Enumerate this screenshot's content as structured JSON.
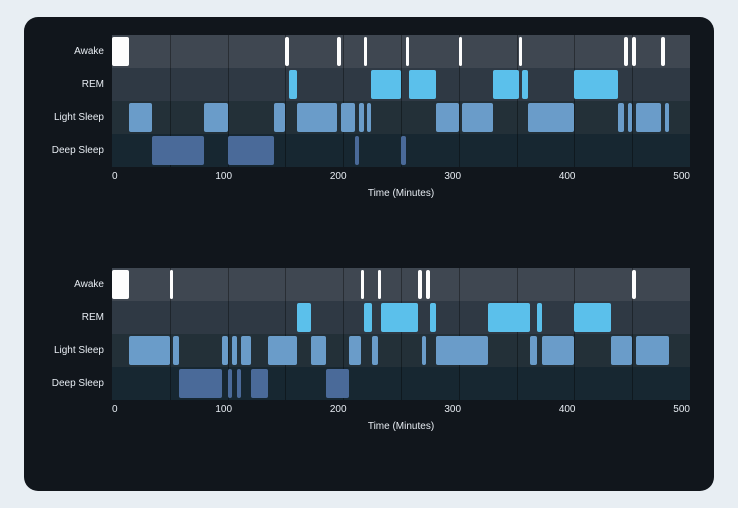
{
  "chart_data": [
    {
      "type": "bar",
      "title": "",
      "xlabel": "Time (Minutes)",
      "ylabel": "",
      "x_range": [
        0,
        500
      ],
      "x_ticks": [
        0,
        100,
        200,
        300,
        400,
        500
      ],
      "categories": [
        "Awake",
        "REM",
        "Light Sleep",
        "Deep Sleep"
      ],
      "colors": {
        "Awake": "#fdfdfd",
        "REM": "#5bc0eb",
        "Light Sleep": "#6a9cc9",
        "Deep Sleep": "#4a6a99"
      },
      "segments": [
        {
          "stage": "Awake",
          "start": 0,
          "end": 15
        },
        {
          "stage": "Light Sleep",
          "start": 15,
          "end": 35
        },
        {
          "stage": "Deep Sleep",
          "start": 35,
          "end": 80
        },
        {
          "stage": "Light Sleep",
          "start": 80,
          "end": 100
        },
        {
          "stage": "Deep Sleep",
          "start": 100,
          "end": 140
        },
        {
          "stage": "Light Sleep",
          "start": 140,
          "end": 150
        },
        {
          "stage": "Awake",
          "start": 150,
          "end": 153
        },
        {
          "stage": "REM",
          "start": 153,
          "end": 160
        },
        {
          "stage": "Light Sleep",
          "start": 160,
          "end": 195
        },
        {
          "stage": "Awake",
          "start": 195,
          "end": 198
        },
        {
          "stage": "Light Sleep",
          "start": 198,
          "end": 210
        },
        {
          "stage": "Deep Sleep",
          "start": 210,
          "end": 214
        },
        {
          "stage": "Light Sleep",
          "start": 214,
          "end": 218
        },
        {
          "stage": "Awake",
          "start": 218,
          "end": 221
        },
        {
          "stage": "Light Sleep",
          "start": 221,
          "end": 224
        },
        {
          "stage": "REM",
          "start": 224,
          "end": 250
        },
        {
          "stage": "Deep Sleep",
          "start": 250,
          "end": 254
        },
        {
          "stage": "Awake",
          "start": 254,
          "end": 257
        },
        {
          "stage": "REM",
          "start": 257,
          "end": 280
        },
        {
          "stage": "Light Sleep",
          "start": 280,
          "end": 300
        },
        {
          "stage": "Awake",
          "start": 300,
          "end": 303
        },
        {
          "stage": "Light Sleep",
          "start": 303,
          "end": 330
        },
        {
          "stage": "REM",
          "start": 330,
          "end": 352
        },
        {
          "stage": "Awake",
          "start": 352,
          "end": 355
        },
        {
          "stage": "REM",
          "start": 355,
          "end": 360
        },
        {
          "stage": "Light Sleep",
          "start": 360,
          "end": 400
        },
        {
          "stage": "REM",
          "start": 400,
          "end": 438
        },
        {
          "stage": "Light Sleep",
          "start": 438,
          "end": 443
        },
        {
          "stage": "Awake",
          "start": 443,
          "end": 446
        },
        {
          "stage": "Light Sleep",
          "start": 446,
          "end": 450
        },
        {
          "stage": "Awake",
          "start": 450,
          "end": 453
        },
        {
          "stage": "Light Sleep",
          "start": 453,
          "end": 475
        },
        {
          "stage": "Awake",
          "start": 475,
          "end": 478
        },
        {
          "stage": "Light Sleep",
          "start": 478,
          "end": 482
        }
      ]
    },
    {
      "type": "bar",
      "title": "",
      "xlabel": "Time (Minutes)",
      "ylabel": "",
      "x_range": [
        0,
        500
      ],
      "x_ticks": [
        0,
        100,
        200,
        300,
        400,
        500
      ],
      "categories": [
        "Awake",
        "REM",
        "Light Sleep",
        "Deep Sleep"
      ],
      "colors": {
        "Awake": "#fdfdfd",
        "REM": "#5bc0eb",
        "Light Sleep": "#6a9cc9",
        "Deep Sleep": "#4a6a99"
      },
      "segments": [
        {
          "stage": "Awake",
          "start": 0,
          "end": 15
        },
        {
          "stage": "Light Sleep",
          "start": 15,
          "end": 50
        },
        {
          "stage": "Awake",
          "start": 50,
          "end": 53
        },
        {
          "stage": "Light Sleep",
          "start": 53,
          "end": 58
        },
        {
          "stage": "Deep Sleep",
          "start": 58,
          "end": 95
        },
        {
          "stage": "Light Sleep",
          "start": 95,
          "end": 100
        },
        {
          "stage": "Deep Sleep",
          "start": 100,
          "end": 104
        },
        {
          "stage": "Light Sleep",
          "start": 104,
          "end": 108
        },
        {
          "stage": "Deep Sleep",
          "start": 108,
          "end": 112
        },
        {
          "stage": "Light Sleep",
          "start": 112,
          "end": 120
        },
        {
          "stage": "Deep Sleep",
          "start": 120,
          "end": 135
        },
        {
          "stage": "Light Sleep",
          "start": 135,
          "end": 160
        },
        {
          "stage": "REM",
          "start": 160,
          "end": 172
        },
        {
          "stage": "Light Sleep",
          "start": 172,
          "end": 185
        },
        {
          "stage": "Deep Sleep",
          "start": 185,
          "end": 205
        },
        {
          "stage": "Light Sleep",
          "start": 205,
          "end": 215
        },
        {
          "stage": "Awake",
          "start": 215,
          "end": 218
        },
        {
          "stage": "REM",
          "start": 218,
          "end": 225
        },
        {
          "stage": "Light Sleep",
          "start": 225,
          "end": 230
        },
        {
          "stage": "Awake",
          "start": 230,
          "end": 233
        },
        {
          "stage": "REM",
          "start": 233,
          "end": 265
        },
        {
          "stage": "Awake",
          "start": 265,
          "end": 268
        },
        {
          "stage": "Light Sleep",
          "start": 268,
          "end": 272
        },
        {
          "stage": "Awake",
          "start": 272,
          "end": 275
        },
        {
          "stage": "REM",
          "start": 275,
          "end": 280
        },
        {
          "stage": "Light Sleep",
          "start": 280,
          "end": 325
        },
        {
          "stage": "REM",
          "start": 325,
          "end": 362
        },
        {
          "stage": "Light Sleep",
          "start": 362,
          "end": 368
        },
        {
          "stage": "REM",
          "start": 368,
          "end": 372
        },
        {
          "stage": "Light Sleep",
          "start": 372,
          "end": 400
        },
        {
          "stage": "REM",
          "start": 400,
          "end": 432
        },
        {
          "stage": "Light Sleep",
          "start": 432,
          "end": 450
        },
        {
          "stage": "Awake",
          "start": 450,
          "end": 453
        },
        {
          "stage": "Light Sleep",
          "start": 453,
          "end": 482
        }
      ]
    }
  ]
}
